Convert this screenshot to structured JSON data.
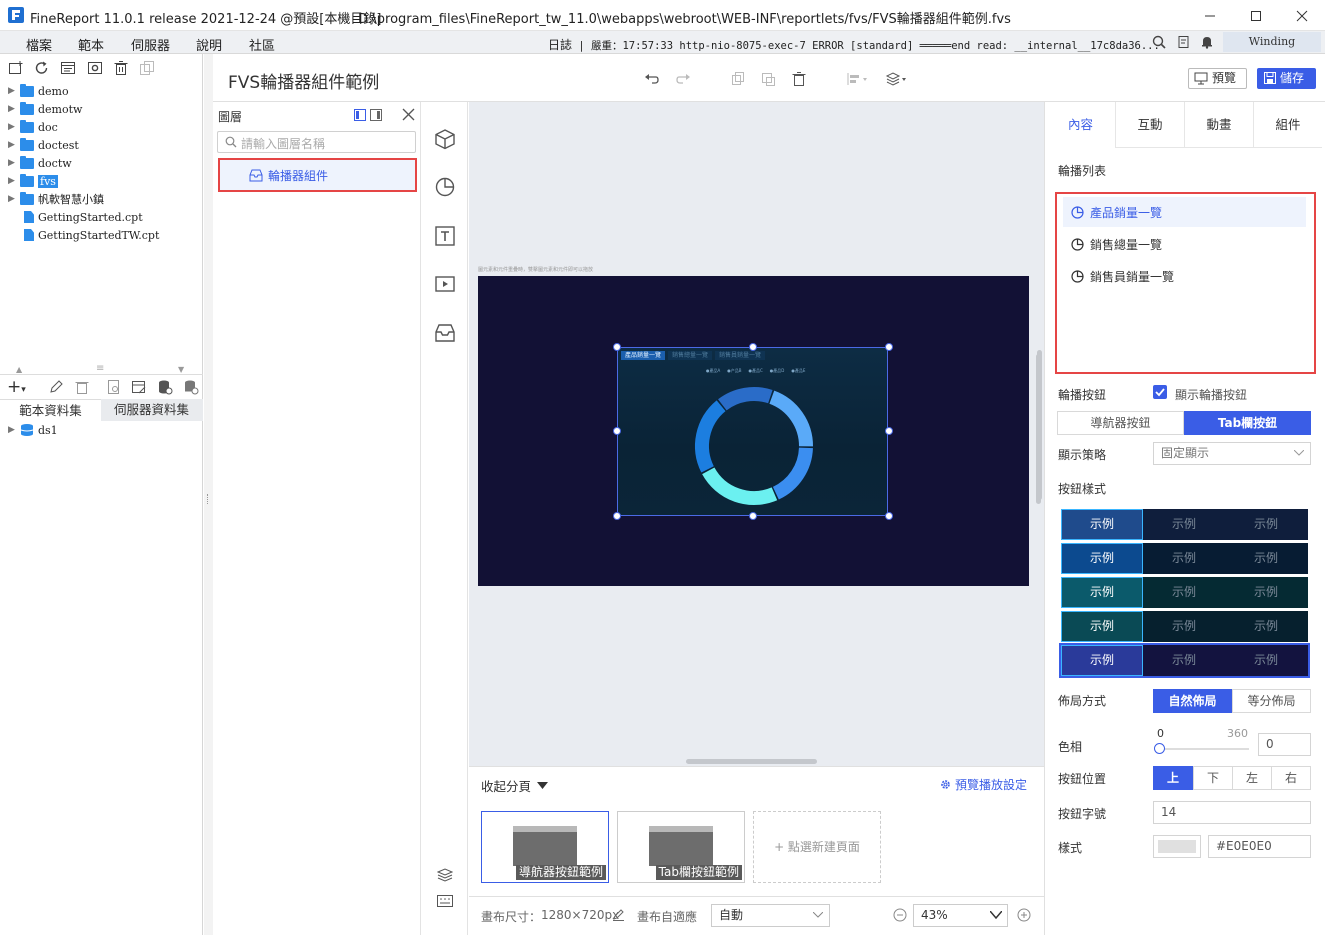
{
  "window": {
    "app_title": "FineReport 11.0.1 release 2021-12-24 @預設[本機目錄]",
    "file_path": "D:\\program_files\\FineReport_tw_11.0\\webapps\\webroot\\WEB-INF\\reportlets/fvs/FVS輪播器組件範例.fvs"
  },
  "menubar": {
    "items": [
      "檔案",
      "範本",
      "伺服器",
      "說明",
      "社區"
    ],
    "log_label": "日誌",
    "log_text": "| 嚴重：17:57:33 http-nio-8075-exec-7 ERROR [standard] ═════end read: __internal__17c8da36...",
    "right_label": "Winding"
  },
  "file_tree": {
    "items": [
      {
        "label": "demo",
        "type": "folder"
      },
      {
        "label": "demotw",
        "type": "folder"
      },
      {
        "label": "doc",
        "type": "folder"
      },
      {
        "label": "doctest",
        "type": "folder"
      },
      {
        "label": "doctw",
        "type": "folder"
      },
      {
        "label": "fvs",
        "type": "folder",
        "selected": true
      },
      {
        "label": "帆軟智慧小鎮",
        "type": "folder"
      },
      {
        "label": "GettingStarted.cpt",
        "type": "file"
      },
      {
        "label": "GettingStartedTW.cpt",
        "type": "file"
      }
    ]
  },
  "dataset_tabs": {
    "tabs": [
      "範本資料集",
      "伺服器資料集"
    ],
    "items": [
      "ds1"
    ]
  },
  "document": {
    "title": "FVS輪播器組件範例",
    "preview_label": "預覽",
    "save_label": "儲存"
  },
  "layer_panel": {
    "title": "圖層",
    "search_placeholder": "請輸入圖層名稱",
    "items": [
      "輪播器組件"
    ]
  },
  "canvas": {
    "hint_text": "圖元素和元件重疊時，雙擊圖元素和元件即可以拖放",
    "carousel_tabs": [
      "產品銷量一覽",
      "銷售總量一覽",
      "銷售員銷量一覽"
    ],
    "legend_items": [
      "●產品A",
      "●产品B",
      "●產品C",
      "●產品D",
      "●產品E"
    ],
    "donut": [
      {
        "label": "產品A",
        "value": 20,
        "color": "#5aaaf8"
      },
      {
        "label": "產品B",
        "value": 18,
        "color": "#3b8ef0"
      },
      {
        "label": "產品C",
        "value": 24,
        "color": "#6bf0f0"
      },
      {
        "label": "產品D",
        "value": 22,
        "color": "#1c7ee0"
      },
      {
        "label": "產品E",
        "value": 16,
        "color": "#2a6cc8"
      }
    ]
  },
  "pages": {
    "collapse_label": "收起分頁",
    "settings_label": "預覽播放設定",
    "cards": [
      "導航器按鈕範例",
      "Tab欄按鈕範例"
    ],
    "new_page_label": "+ 點選新建頁面"
  },
  "status": {
    "canvas_size_label": "畫布尺寸：",
    "canvas_size_value": "1280×720px",
    "adapt_label": "畫布自適應",
    "adapt_value": "自動",
    "zoom_value": "43%"
  },
  "right_panel": {
    "tabs": [
      "內容",
      "互動",
      "動畫",
      "組件"
    ],
    "active_tab": 0,
    "carousel_list_label": "輪播列表",
    "carousel_list": [
      "產品銷量一覽",
      "銷售總量一覽",
      "銷售員銷量一覽"
    ],
    "carousel_button_label": "輪播按鈕",
    "show_button_label": "顯示輪播按鈕",
    "show_button_checked": true,
    "button_types": [
      "導航器按鈕",
      "Tab欄按鈕"
    ],
    "active_button_type": 1,
    "display_strategy_label": "顯示策略",
    "display_strategy_value": "固定顯示",
    "button_style_label": "按鈕樣式",
    "style_samples": [
      "示例",
      "示例",
      "示例"
    ],
    "layout_label": "佈局方式",
    "layout_options": [
      "自然佈局",
      "等分佈局"
    ],
    "active_layout": 0,
    "hue_label": "色相",
    "hue_min": "0",
    "hue_max": "360",
    "hue_value": "0",
    "position_label": "按鈕位置",
    "positions": [
      "上",
      "下",
      "左",
      "右"
    ],
    "active_position": 0,
    "font_size_label": "按鈕字號",
    "font_size_value": "14",
    "style_label": "樣式",
    "style_color": "#E0E0E0"
  }
}
